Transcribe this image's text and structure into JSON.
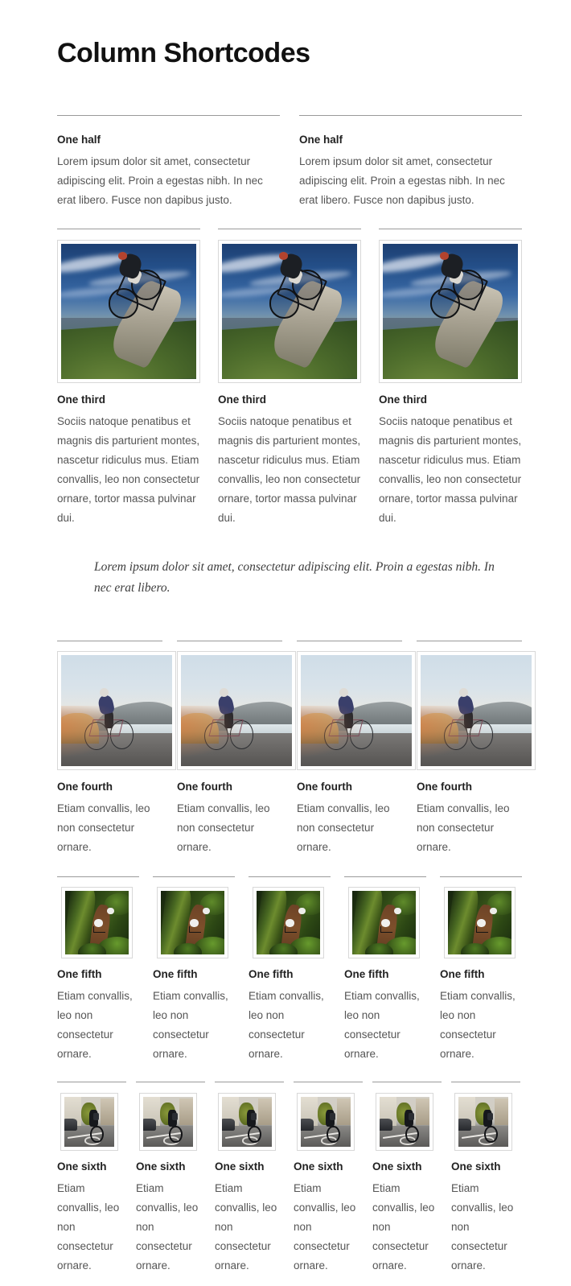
{
  "page": {
    "title": "Column Shortcodes"
  },
  "halves": {
    "items": [
      {
        "heading": "One half",
        "body": "Lorem ipsum dolor sit amet, consectetur adipiscing elit. Proin a egestas nibh. In nec erat libero. Fusce non dapibus justo."
      },
      {
        "heading": "One half",
        "body": "Lorem ipsum dolor sit amet, consectetur adipiscing elit. Proin a egestas nibh. In nec erat libero. Fusce non dapibus justo."
      }
    ]
  },
  "thirds": {
    "items": [
      {
        "heading": "One third",
        "body": "Sociis natoque penatibus et magnis dis parturient montes, nascetur ridiculus mus. Etiam convallis, leo non consectetur ornare, tortor massa pulvinar dui.",
        "image": "mountain-biker-on-rocky-ridge-photo"
      },
      {
        "heading": "One third",
        "body": "Sociis natoque penatibus et magnis dis parturient montes, nascetur ridiculus mus. Etiam convallis, leo non consectetur ornare, tortor massa pulvinar dui.",
        "image": "mountain-biker-on-rocky-ridge-photo"
      },
      {
        "heading": "One third",
        "body": "Sociis natoque penatibus et magnis dis parturient montes, nascetur ridiculus mus. Etiam convallis, leo non consectetur ornare, tortor massa pulvinar dui.",
        "image": "mountain-biker-on-rocky-ridge-photo"
      }
    ]
  },
  "quote": {
    "text": "Lorem ipsum dolor sit amet, consectetur adipiscing elit. Proin a egestas nibh. In nec erat libero."
  },
  "fourths": {
    "items": [
      {
        "heading": "One fourth",
        "body": "Etiam convallis, leo non consectetur ornare.",
        "image": "road-cyclist-sunset-photo"
      },
      {
        "heading": "One fourth",
        "body": "Etiam convallis, leo non consectetur ornare.",
        "image": "road-cyclist-sunset-photo"
      },
      {
        "heading": "One fourth",
        "body": "Etiam convallis, leo non consectetur ornare.",
        "image": "road-cyclist-sunset-photo"
      },
      {
        "heading": "One fourth",
        "body": "Etiam convallis, leo non consectetur ornare.",
        "image": "road-cyclist-sunset-photo"
      }
    ]
  },
  "fifths": {
    "items": [
      {
        "heading": "One fifth",
        "body": "Etiam convallis, leo non consectetur ornare.",
        "image": "forest-trail-riders-photo"
      },
      {
        "heading": "One fifth",
        "body": "Etiam convallis, leo non consectetur ornare.",
        "image": "forest-trail-riders-photo"
      },
      {
        "heading": "One fifth",
        "body": "Etiam convallis, leo non consectetur ornare.",
        "image": "forest-trail-riders-photo"
      },
      {
        "heading": "One fifth",
        "body": "Etiam convallis, leo non consectetur ornare.",
        "image": "forest-trail-riders-photo"
      },
      {
        "heading": "One fifth",
        "body": "Etiam convallis, leo non consectetur ornare.",
        "image": "forest-trail-riders-photo"
      }
    ]
  },
  "sixths": {
    "items": [
      {
        "heading": "One sixth",
        "body": "Etiam convallis, leo non consectetur ornare.",
        "image": "urban-cyclist-bike-lane-photo"
      },
      {
        "heading": "One sixth",
        "body": "Etiam convallis, leo non consectetur ornare.",
        "image": "urban-cyclist-bike-lane-photo"
      },
      {
        "heading": "One sixth",
        "body": "Etiam convallis, leo non consectetur ornare.",
        "image": "urban-cyclist-bike-lane-photo"
      },
      {
        "heading": "One sixth",
        "body": "Etiam convallis, leo non consectetur ornare.",
        "image": "urban-cyclist-bike-lane-photo"
      },
      {
        "heading": "One sixth",
        "body": "Etiam convallis, leo non consectetur ornare.",
        "image": "urban-cyclist-bike-lane-photo"
      },
      {
        "heading": "One sixth",
        "body": "Etiam convallis, leo non consectetur ornare.",
        "image": "urban-cyclist-bike-lane-photo"
      }
    ]
  },
  "colors": {
    "heading": "#222222",
    "body_text": "#555555",
    "rule": "#9a9a9a",
    "image_border": "#d8d8d8",
    "page_background": "#ffffff"
  }
}
